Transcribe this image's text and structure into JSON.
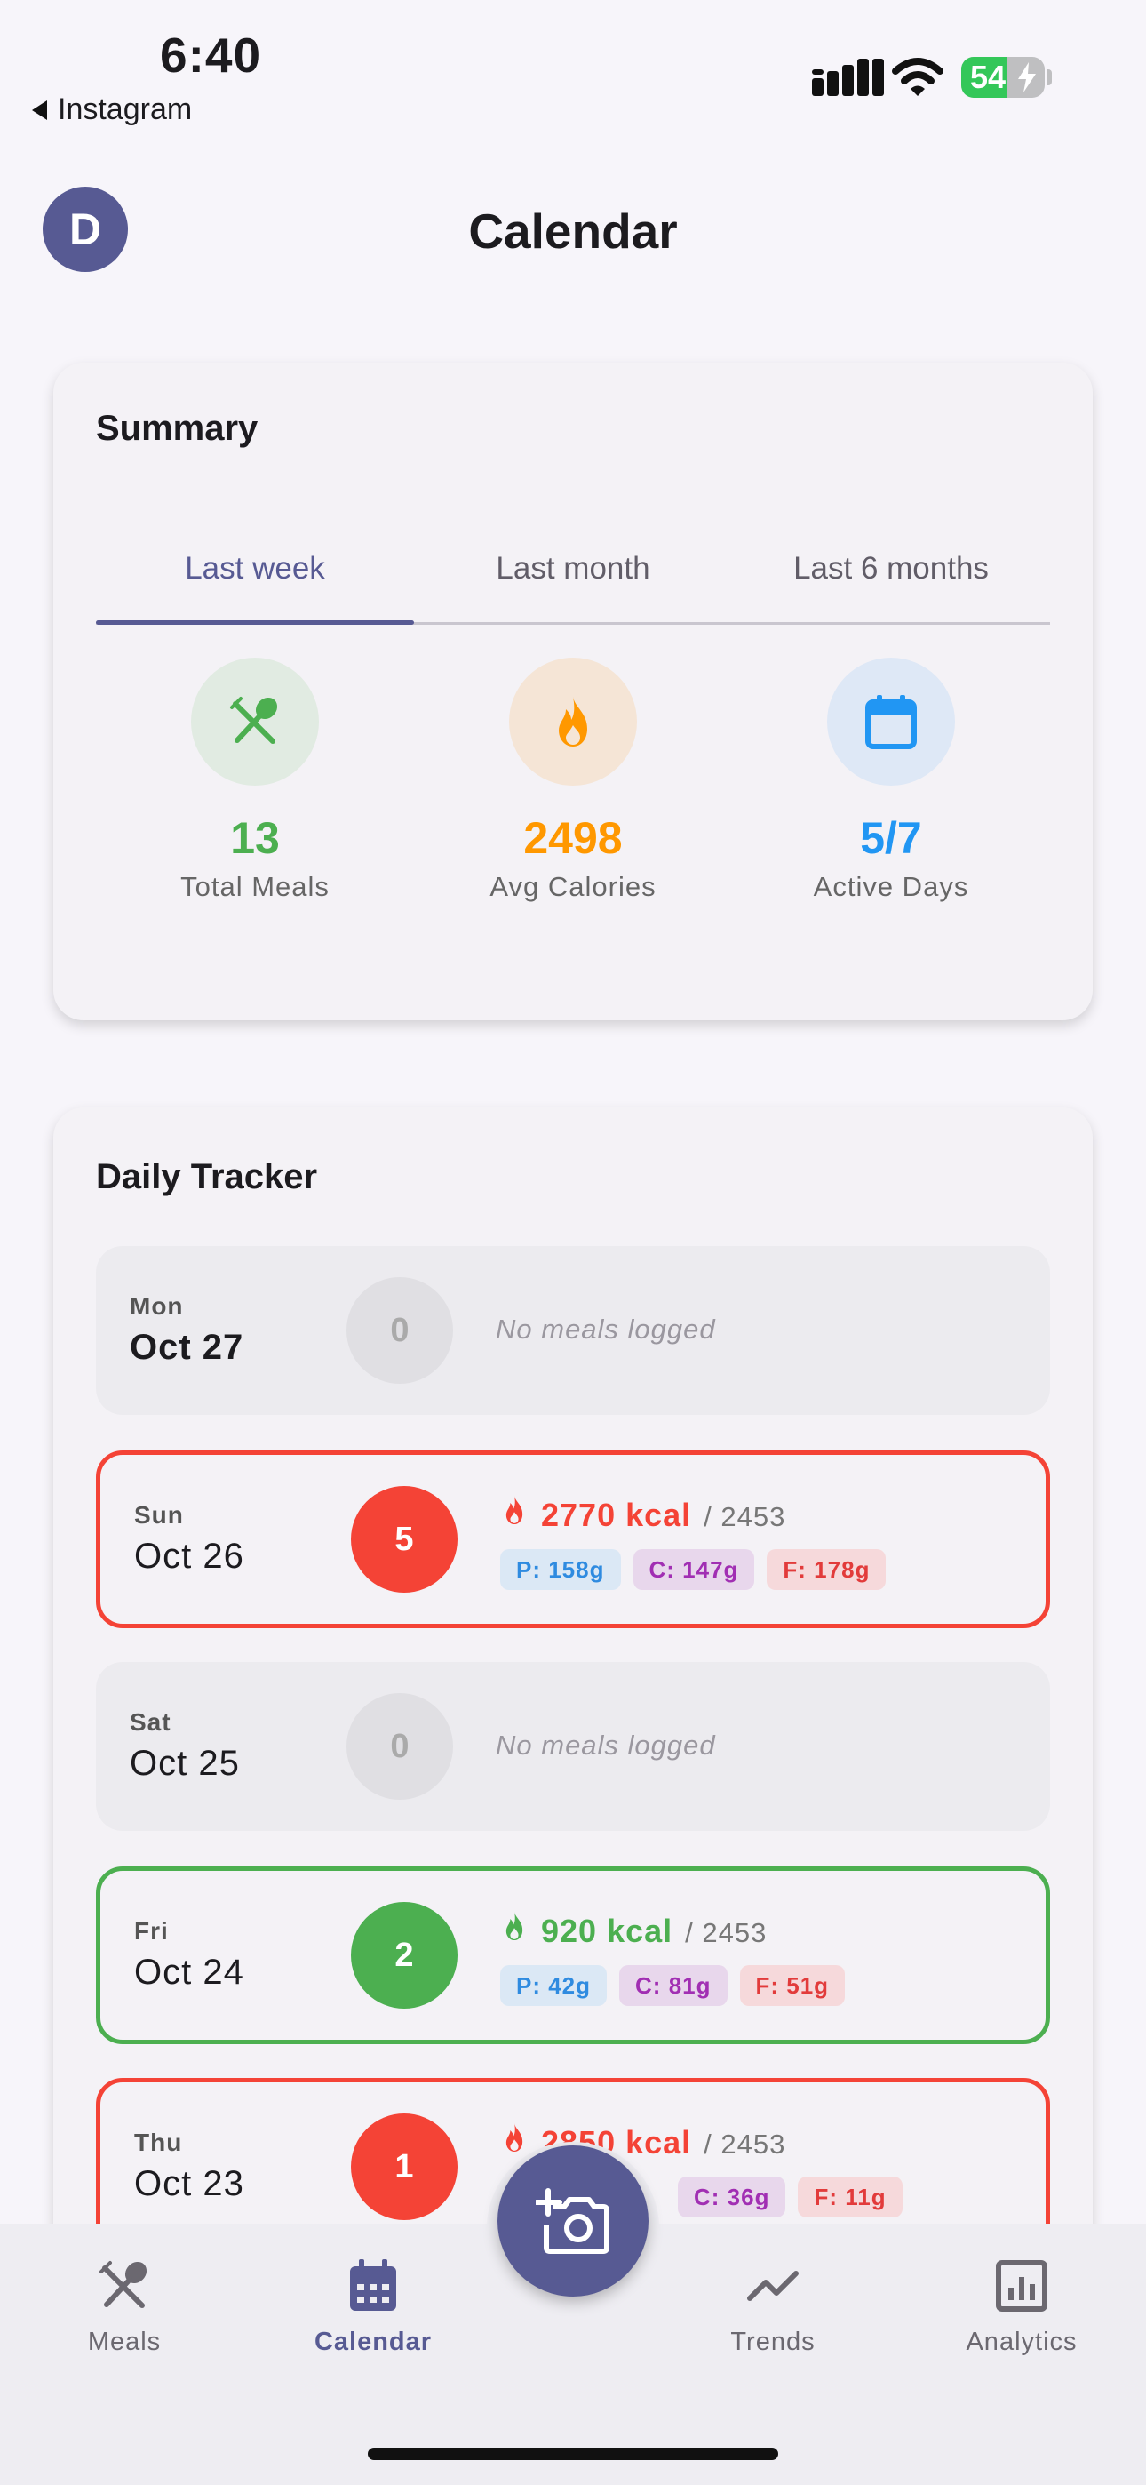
{
  "status_bar": {
    "time": "6:40",
    "back_app": "Instagram",
    "battery": "54",
    "battery_level_pct": 54
  },
  "header": {
    "avatar_initial": "D",
    "title": "Calendar"
  },
  "summary": {
    "title": "Summary",
    "tabs": [
      {
        "label": "Last week",
        "active": true
      },
      {
        "label": "Last month",
        "active": false
      },
      {
        "label": "Last 6 months",
        "active": false
      }
    ],
    "stats": [
      {
        "icon": "utensils-icon",
        "value": "13",
        "label": "Total Meals",
        "color": "#4caf50"
      },
      {
        "icon": "flame-icon",
        "value": "2498",
        "label": "Avg Calories",
        "color": "#ff9800"
      },
      {
        "icon": "calendar-icon",
        "value": "5/7",
        "label": "Active Days",
        "color": "#2196f3"
      }
    ]
  },
  "tracker": {
    "title": "Daily Tracker",
    "empty_text": "No meals logged",
    "days": [
      {
        "dow": "Mon",
        "date": "Oct 27",
        "count": "0",
        "status": "empty"
      },
      {
        "dow": "Sun",
        "date": "Oct 26",
        "count": "5",
        "status": "over",
        "kcal": "2770 kcal",
        "goal": "/ 2453",
        "protein": "P: 158g",
        "carbs": "C: 147g",
        "fat": "F: 178g"
      },
      {
        "dow": "Sat",
        "date": "Oct 25",
        "count": "0",
        "status": "empty"
      },
      {
        "dow": "Fri",
        "date": "Oct 24",
        "count": "2",
        "status": "under",
        "kcal": "920 kcal",
        "goal": "/ 2453",
        "protein": "P: 42g",
        "carbs": "C: 81g",
        "fat": "F: 51g"
      },
      {
        "dow": "Thu",
        "date": "Oct 23",
        "count": "1",
        "status": "over",
        "kcal": "2850 kcal",
        "goal": "/ 2453",
        "carbs": "C: 36g",
        "fat": "F: 11g"
      }
    ]
  },
  "nav": {
    "items": [
      {
        "icon": "utensils-icon",
        "label": "Meals",
        "active": false
      },
      {
        "icon": "calendar-icon",
        "label": "Calendar",
        "active": true
      },
      {
        "icon": "trend-line-icon",
        "label": "Trends",
        "active": false
      },
      {
        "icon": "bar-chart-icon",
        "label": "Analytics",
        "active": false
      }
    ],
    "fab_icon": "add-photo-camera-icon"
  },
  "colors": {
    "primary": "#575a93",
    "over": "#f44336",
    "under": "#4caf50",
    "calories": "#ff9800",
    "days": "#2196f3"
  }
}
